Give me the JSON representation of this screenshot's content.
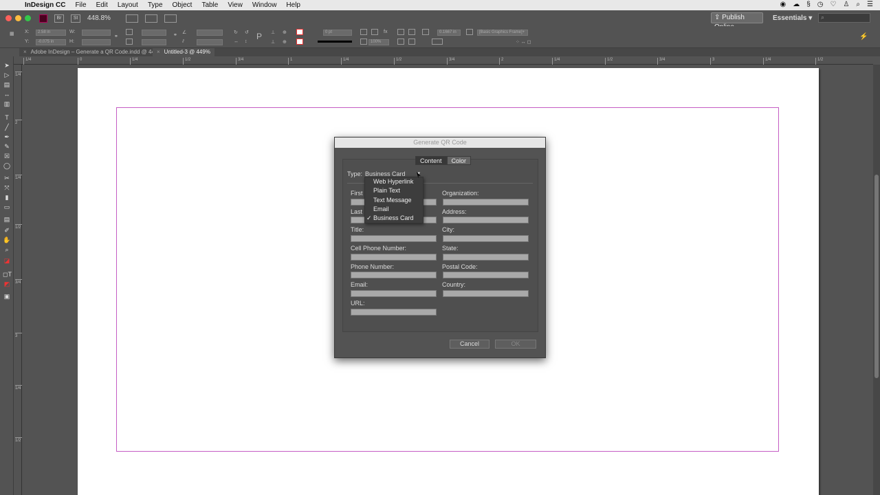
{
  "menubar": {
    "app_name": "InDesign CC",
    "items": [
      "File",
      "Edit",
      "Layout",
      "Type",
      "Object",
      "Table",
      "View",
      "Window",
      "Help"
    ]
  },
  "appbar": {
    "zoom": "448.8%",
    "publish_label": "Publish Online",
    "workspace": "Essentials",
    "workspace_arrow": "▾",
    "search_icon": "⌕"
  },
  "control_panel": {
    "x_value": "2.58 in",
    "y_value": "-0.075 in",
    "stroke_weight": "0 pt",
    "opacity": "100%",
    "offset": "0.1667 in",
    "object_style": "[Basic Graphics Frame]+"
  },
  "doc_tabs": [
    {
      "label": "Adobe InDesign – Generate a QR Code.indd @ 449%",
      "close": "×"
    },
    {
      "label": "Untitled-3 @ 449%",
      "close": "×"
    }
  ],
  "ruler_marks": [
    "1/4",
    "0",
    "1/4",
    "1/2",
    "3/4",
    "1",
    "1/4",
    "1/2",
    "3/4",
    "2",
    "1/4",
    "1/2",
    "3/4",
    "3",
    "1/4",
    "1/2"
  ],
  "vruler_marks": [
    "1/4",
    "2",
    "1/4",
    "1/2",
    "3/4",
    "3",
    "1/4",
    "1/2",
    "3/4",
    "1",
    "1/4",
    "1/2"
  ],
  "dialog": {
    "title": "Generate QR Code",
    "tab_content": "Content",
    "tab_color": "Color",
    "type_label": "Type:",
    "type_value": "Business Card",
    "type_arrow": "▾",
    "dropdown_options": [
      "Web Hyperlink",
      "Plain Text",
      "Text Message",
      "Email",
      "Business Card"
    ],
    "dropdown_selected_check": "✓",
    "left_labels": [
      "First",
      "Last",
      "Title:",
      "Cell Phone Number:",
      "Phone Number:",
      "Email:",
      "URL:"
    ],
    "right_labels": [
      "Organization:",
      "Address:",
      "City:",
      "State:",
      "Postal Code:",
      "Country:"
    ],
    "cancel_label": "Cancel",
    "ok_label": "OK"
  }
}
